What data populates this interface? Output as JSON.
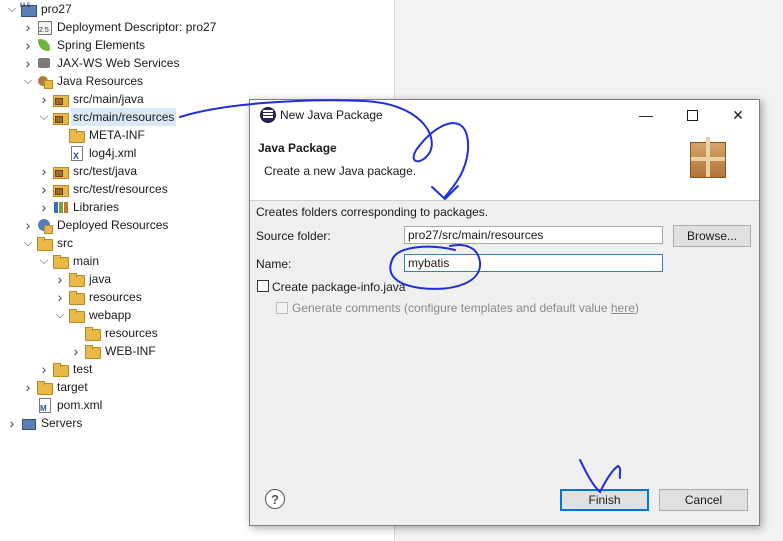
{
  "explorer": {
    "items": [
      {
        "label": "pro27",
        "icon": "maven-project-icon",
        "depth": 0,
        "expanded": true
      },
      {
        "label": "Deployment Descriptor: pro27",
        "icon": "deployment-descriptor-icon",
        "depth": 1,
        "expanded": false
      },
      {
        "label": "Spring Elements",
        "icon": "spring-icon",
        "depth": 1,
        "expanded": false
      },
      {
        "label": "JAX-WS Web Services",
        "icon": "jaxws-icon",
        "depth": 1,
        "expanded": false
      },
      {
        "label": "Java Resources",
        "icon": "java-resources-icon",
        "depth": 1,
        "expanded": true
      },
      {
        "label": "src/main/java",
        "icon": "source-folder-icon",
        "depth": 2,
        "expanded": false
      },
      {
        "label": "src/main/resources",
        "icon": "source-folder-icon",
        "depth": 2,
        "expanded": true,
        "selected": true
      },
      {
        "label": "META-INF",
        "icon": "folder-icon",
        "depth": 3,
        "leaf": true
      },
      {
        "label": "log4j.xml",
        "icon": "xml-file-icon",
        "depth": 3,
        "leaf": true
      },
      {
        "label": "src/test/java",
        "icon": "source-folder-icon",
        "depth": 2,
        "expanded": false
      },
      {
        "label": "src/test/resources",
        "icon": "source-folder-icon",
        "depth": 2,
        "expanded": false
      },
      {
        "label": "Libraries",
        "icon": "libraries-icon",
        "depth": 2,
        "expanded": false
      },
      {
        "label": "Deployed Resources",
        "icon": "deployed-resources-icon",
        "depth": 1,
        "expanded": false
      },
      {
        "label": "src",
        "icon": "folder-icon",
        "depth": 1,
        "expanded": true
      },
      {
        "label": "main",
        "icon": "folder-icon",
        "depth": 2,
        "expanded": true
      },
      {
        "label": "java",
        "icon": "folder-icon",
        "depth": 3,
        "expanded": false
      },
      {
        "label": "resources",
        "icon": "folder-icon",
        "depth": 3,
        "expanded": false
      },
      {
        "label": "webapp",
        "icon": "folder-icon",
        "depth": 3,
        "expanded": true
      },
      {
        "label": "resources",
        "icon": "folder-icon",
        "depth": 4,
        "leaf": true
      },
      {
        "label": "WEB-INF",
        "icon": "folder-icon",
        "depth": 4,
        "expanded": false
      },
      {
        "label": "test",
        "icon": "folder-icon",
        "depth": 2,
        "expanded": false
      },
      {
        "label": "target",
        "icon": "folder-icon",
        "depth": 1,
        "expanded": false
      },
      {
        "label": "pom.xml",
        "icon": "pom-file-icon",
        "depth": 1,
        "leaf": true
      },
      {
        "label": "Servers",
        "icon": "servers-icon",
        "depth": 0,
        "expanded": false
      }
    ]
  },
  "dialog": {
    "title": "New Java Package",
    "heading": "Java Package",
    "subheading": "Create a new Java package.",
    "description": "Creates folders corresponding to packages.",
    "source_folder_label": "Source folder:",
    "source_folder_value": "pro27/src/main/resources",
    "browse_label": "Browse...",
    "name_label": "Name:",
    "name_value": "mybatis",
    "create_package_info_label": "Create package-info.java",
    "generate_comments_label": "Generate comments (configure templates and default value ",
    "generate_comments_link": "here",
    "generate_comments_suffix": ")",
    "help_symbol": "?",
    "finish_label": "Finish",
    "cancel_label": "Cancel",
    "minimize_symbol": "—",
    "close_symbol": "✕"
  },
  "colors": {
    "annotation_ink": "#1f2fd6",
    "selection": "#dbe8f7",
    "default_button_border": "#0078d7"
  }
}
